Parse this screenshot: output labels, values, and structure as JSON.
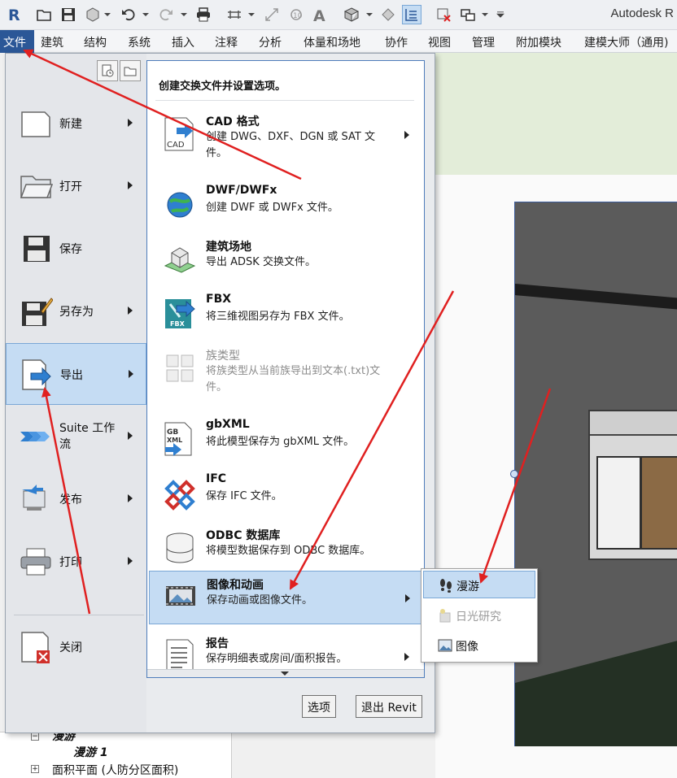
{
  "app": {
    "title": "Autodesk R"
  },
  "colors": {
    "accent": "#2b5797",
    "highlight": "#c5dcf3",
    "annotation_arrow": "#e02020"
  },
  "qat": {
    "icons": [
      "revit-logo-icon",
      "open-icon",
      "save-icon",
      "sync-icon",
      "undo-icon",
      "redo-icon",
      "print-icon",
      "measure-icon",
      "dimension-icon",
      "tag-icon",
      "text-icon",
      "3d-view-icon",
      "section-icon",
      "thin-lines-icon",
      "close-windows-icon",
      "switch-windows-icon",
      "customize-icon"
    ]
  },
  "tabs": [
    "文件",
    "建筑",
    "结构",
    "系统",
    "插入",
    "注释",
    "分析",
    "体量和场地",
    "协作",
    "视图",
    "管理",
    "附加模块",
    "建模大师（通用)"
  ],
  "menu": {
    "items": [
      {
        "label": "新建",
        "icon": "new-file-icon"
      },
      {
        "label": "打开",
        "icon": "open-folder-icon"
      },
      {
        "label": "保存",
        "icon": "save-icon"
      },
      {
        "label": "另存为",
        "icon": "save-as-icon"
      },
      {
        "label": "导出",
        "icon": "export-icon"
      },
      {
        "label": "Suite 工作流",
        "icon": "suite-workflow-icon"
      },
      {
        "label": "发布",
        "icon": "publish-icon"
      },
      {
        "label": "打印",
        "icon": "print-icon"
      },
      {
        "label": "关闭",
        "icon": "close-file-icon"
      }
    ]
  },
  "export_panel": {
    "heading": "创建交换文件并设置选项。",
    "items": [
      {
        "title": "CAD 格式",
        "desc": "创建 DWG、DXF、DGN 或 SAT 文件。",
        "icon": "cad-format-icon"
      },
      {
        "title": "DWF/DWFx",
        "desc": "创建 DWF 或 DWFx 文件。",
        "icon": "dwf-globe-icon"
      },
      {
        "title": "建筑场地",
        "desc": "导出 ADSK 交换文件。",
        "icon": "building-site-icon"
      },
      {
        "title": "FBX",
        "desc": "将三维视图另存为 FBX 文件。",
        "icon": "fbx-icon"
      },
      {
        "title": "族类型",
        "desc": "将族类型从当前族导出到文本(.txt)文件。",
        "icon": "family-types-icon"
      },
      {
        "title": "gbXML",
        "desc": "将此模型保存为 gbXML 文件。",
        "icon": "gbxml-icon"
      },
      {
        "title": "IFC",
        "desc": "保存 IFC 文件。",
        "icon": "ifc-icon"
      },
      {
        "title": "ODBC 数据库",
        "desc": "将模型数据保存到 ODBC 数据库。",
        "icon": "odbc-database-icon"
      },
      {
        "title": "图像和动画",
        "desc": "保存动画或图像文件。",
        "icon": "image-animation-icon"
      },
      {
        "title": "报告",
        "desc": "保存明细表或房间/面积报告。",
        "icon": "report-icon"
      }
    ]
  },
  "buttons": {
    "options": "选项",
    "exit": "退出 Revit"
  },
  "flyout": {
    "items": [
      {
        "label": "漫游",
        "icon": "walkthrough-footprints-icon"
      },
      {
        "label": "日光研究",
        "icon": "solar-study-icon"
      },
      {
        "label": "图像",
        "icon": "image-icon"
      }
    ]
  },
  "project_browser": {
    "items": [
      "漫游",
      "漫游 1",
      "面积平面 (人防分区面积)"
    ]
  }
}
